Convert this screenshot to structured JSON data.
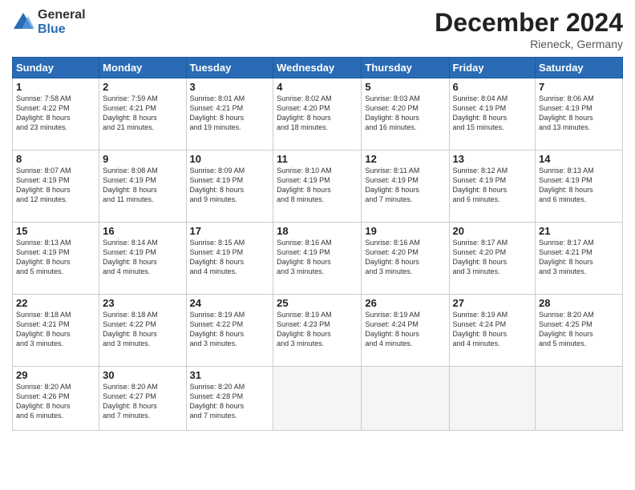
{
  "logo": {
    "general": "General",
    "blue": "Blue"
  },
  "title": "December 2024",
  "location": "Rieneck, Germany",
  "days_header": [
    "Sunday",
    "Monday",
    "Tuesday",
    "Wednesday",
    "Thursday",
    "Friday",
    "Saturday"
  ],
  "weeks": [
    [
      {
        "day": "1",
        "info": "Sunrise: 7:58 AM\nSunset: 4:22 PM\nDaylight: 8 hours\nand 23 minutes."
      },
      {
        "day": "2",
        "info": "Sunrise: 7:59 AM\nSunset: 4:21 PM\nDaylight: 8 hours\nand 21 minutes."
      },
      {
        "day": "3",
        "info": "Sunrise: 8:01 AM\nSunset: 4:21 PM\nDaylight: 8 hours\nand 19 minutes."
      },
      {
        "day": "4",
        "info": "Sunrise: 8:02 AM\nSunset: 4:20 PM\nDaylight: 8 hours\nand 18 minutes."
      },
      {
        "day": "5",
        "info": "Sunrise: 8:03 AM\nSunset: 4:20 PM\nDaylight: 8 hours\nand 16 minutes."
      },
      {
        "day": "6",
        "info": "Sunrise: 8:04 AM\nSunset: 4:19 PM\nDaylight: 8 hours\nand 15 minutes."
      },
      {
        "day": "7",
        "info": "Sunrise: 8:06 AM\nSunset: 4:19 PM\nDaylight: 8 hours\nand 13 minutes."
      }
    ],
    [
      {
        "day": "8",
        "info": "Sunrise: 8:07 AM\nSunset: 4:19 PM\nDaylight: 8 hours\nand 12 minutes."
      },
      {
        "day": "9",
        "info": "Sunrise: 8:08 AM\nSunset: 4:19 PM\nDaylight: 8 hours\nand 11 minutes."
      },
      {
        "day": "10",
        "info": "Sunrise: 8:09 AM\nSunset: 4:19 PM\nDaylight: 8 hours\nand 9 minutes."
      },
      {
        "day": "11",
        "info": "Sunrise: 8:10 AM\nSunset: 4:19 PM\nDaylight: 8 hours\nand 8 minutes."
      },
      {
        "day": "12",
        "info": "Sunrise: 8:11 AM\nSunset: 4:19 PM\nDaylight: 8 hours\nand 7 minutes."
      },
      {
        "day": "13",
        "info": "Sunrise: 8:12 AM\nSunset: 4:19 PM\nDaylight: 8 hours\nand 6 minutes."
      },
      {
        "day": "14",
        "info": "Sunrise: 8:13 AM\nSunset: 4:19 PM\nDaylight: 8 hours\nand 6 minutes."
      }
    ],
    [
      {
        "day": "15",
        "info": "Sunrise: 8:13 AM\nSunset: 4:19 PM\nDaylight: 8 hours\nand 5 minutes."
      },
      {
        "day": "16",
        "info": "Sunrise: 8:14 AM\nSunset: 4:19 PM\nDaylight: 8 hours\nand 4 minutes."
      },
      {
        "day": "17",
        "info": "Sunrise: 8:15 AM\nSunset: 4:19 PM\nDaylight: 8 hours\nand 4 minutes."
      },
      {
        "day": "18",
        "info": "Sunrise: 8:16 AM\nSunset: 4:19 PM\nDaylight: 8 hours\nand 3 minutes."
      },
      {
        "day": "19",
        "info": "Sunrise: 8:16 AM\nSunset: 4:20 PM\nDaylight: 8 hours\nand 3 minutes."
      },
      {
        "day": "20",
        "info": "Sunrise: 8:17 AM\nSunset: 4:20 PM\nDaylight: 8 hours\nand 3 minutes."
      },
      {
        "day": "21",
        "info": "Sunrise: 8:17 AM\nSunset: 4:21 PM\nDaylight: 8 hours\nand 3 minutes."
      }
    ],
    [
      {
        "day": "22",
        "info": "Sunrise: 8:18 AM\nSunset: 4:21 PM\nDaylight: 8 hours\nand 3 minutes."
      },
      {
        "day": "23",
        "info": "Sunrise: 8:18 AM\nSunset: 4:22 PM\nDaylight: 8 hours\nand 3 minutes."
      },
      {
        "day": "24",
        "info": "Sunrise: 8:19 AM\nSunset: 4:22 PM\nDaylight: 8 hours\nand 3 minutes."
      },
      {
        "day": "25",
        "info": "Sunrise: 8:19 AM\nSunset: 4:23 PM\nDaylight: 8 hours\nand 3 minutes."
      },
      {
        "day": "26",
        "info": "Sunrise: 8:19 AM\nSunset: 4:24 PM\nDaylight: 8 hours\nand 4 minutes."
      },
      {
        "day": "27",
        "info": "Sunrise: 8:19 AM\nSunset: 4:24 PM\nDaylight: 8 hours\nand 4 minutes."
      },
      {
        "day": "28",
        "info": "Sunrise: 8:20 AM\nSunset: 4:25 PM\nDaylight: 8 hours\nand 5 minutes."
      }
    ],
    [
      {
        "day": "29",
        "info": "Sunrise: 8:20 AM\nSunset: 4:26 PM\nDaylight: 8 hours\nand 6 minutes."
      },
      {
        "day": "30",
        "info": "Sunrise: 8:20 AM\nSunset: 4:27 PM\nDaylight: 8 hours\nand 7 minutes."
      },
      {
        "day": "31",
        "info": "Sunrise: 8:20 AM\nSunset: 4:28 PM\nDaylight: 8 hours\nand 7 minutes."
      },
      {
        "day": "",
        "info": ""
      },
      {
        "day": "",
        "info": ""
      },
      {
        "day": "",
        "info": ""
      },
      {
        "day": "",
        "info": ""
      }
    ]
  ]
}
